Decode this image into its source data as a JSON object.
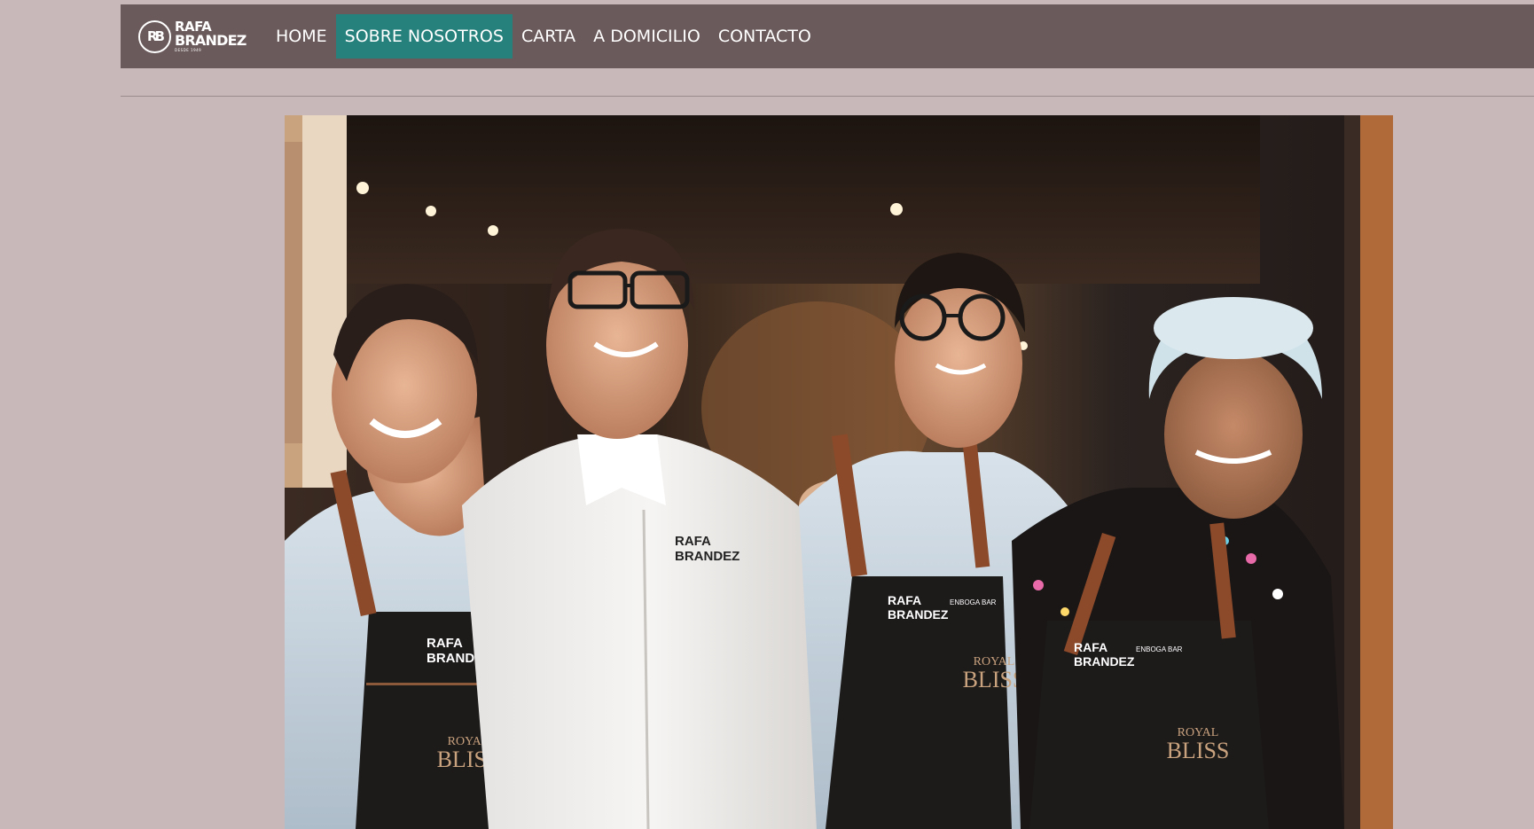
{
  "brand": {
    "logo_mark": "RB",
    "line1": "RAFA",
    "line2": "BRANDEZ",
    "tagline": "DESDE 1949"
  },
  "nav": {
    "items": [
      {
        "label": "HOME",
        "active": false
      },
      {
        "label": "SOBRE NOSOTROS",
        "active": true
      },
      {
        "label": "CARTA",
        "active": false
      },
      {
        "label": "A DOMICILIO",
        "active": false
      },
      {
        "label": "CONTACTO",
        "active": false
      }
    ]
  },
  "hero": {
    "chef_jacket_text": [
      "RAFA",
      "BRANDEZ"
    ],
    "apron_brand": [
      "RAFA",
      "BRANDEZ"
    ],
    "apron_sub": "ENBOGA BAR",
    "apron_logo": [
      "ROYAL",
      "BLISS"
    ]
  },
  "colors": {
    "page_bg": "#c8b8b9",
    "navbar_bg": "#6b5a5b",
    "active_tab": "#26807c",
    "nav_text": "#ffffff"
  }
}
